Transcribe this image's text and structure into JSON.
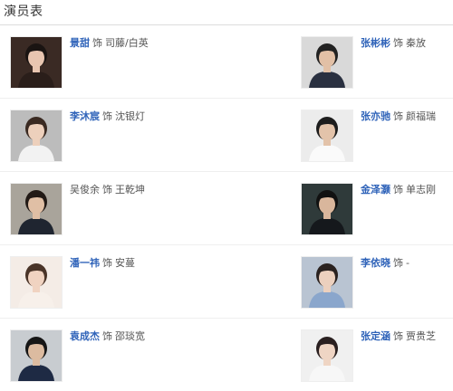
{
  "header": {
    "title": "演员表"
  },
  "role_word": "饰",
  "cast": [
    {
      "left": {
        "actor": "景甜",
        "role": "司藤/白英",
        "linked": true,
        "colors": {
          "bg": "#3a2a24",
          "skin": "#e8c5b0",
          "hair": "#1a1412",
          "cloth": "#2a1e1a"
        }
      },
      "right": {
        "actor": "张彬彬",
        "role": "秦放",
        "linked": true,
        "colors": {
          "bg": "#d9d9d9",
          "skin": "#e2c0a6",
          "hair": "#222222",
          "cloth": "#2a3040"
        }
      }
    },
    {
      "left": {
        "actor": "李沐宸",
        "role": "沈银灯",
        "linked": true,
        "colors": {
          "bg": "#bcbcbc",
          "skin": "#edd0bc",
          "hair": "#3a2a22",
          "cloth": "#f2f2f2"
        }
      },
      "right": {
        "actor": "张亦驰",
        "role": "颜福瑞",
        "linked": true,
        "colors": {
          "bg": "#ececec",
          "skin": "#e3c3aa",
          "hair": "#1d1d1d",
          "cloth": "#fafafa"
        }
      }
    },
    {
      "left": {
        "actor": "吴俊余",
        "role": "王乾坤",
        "linked": false,
        "colors": {
          "bg": "#a9a49b",
          "skin": "#e0bfa5",
          "hair": "#221a16",
          "cloth": "#1f2530"
        }
      },
      "right": {
        "actor": "金泽灏",
        "role": "单志刚",
        "linked": true,
        "colors": {
          "bg": "#2f3a3a",
          "skin": "#d9b69c",
          "hair": "#111111",
          "cloth": "#15181c"
        }
      }
    },
    {
      "left": {
        "actor": "潘一祎",
        "role": "安蔓",
        "linked": true,
        "colors": {
          "bg": "#f4ece6",
          "skin": "#f0d3c1",
          "hair": "#4a3428",
          "cloth": "#f7f0ea"
        }
      },
      "right": {
        "actor": "李依晓",
        "role": "-",
        "linked": true,
        "colors": {
          "bg": "#b9c4d2",
          "skin": "#ecd0be",
          "hair": "#2a2220",
          "cloth": "#8aa6cc"
        }
      }
    },
    {
      "left": {
        "actor": "袁成杰",
        "role": "邵琰宽",
        "linked": true,
        "colors": {
          "bg": "#c8ccd0",
          "skin": "#dcbba0",
          "hair": "#161616",
          "cloth": "#1e2a44"
        }
      },
      "right": {
        "actor": "张定涵",
        "role": "贾贵芝",
        "linked": true,
        "colors": {
          "bg": "#f0f0f0",
          "skin": "#efd5c4",
          "hair": "#2a2020",
          "cloth": "#f7f7f7"
        }
      }
    }
  ]
}
